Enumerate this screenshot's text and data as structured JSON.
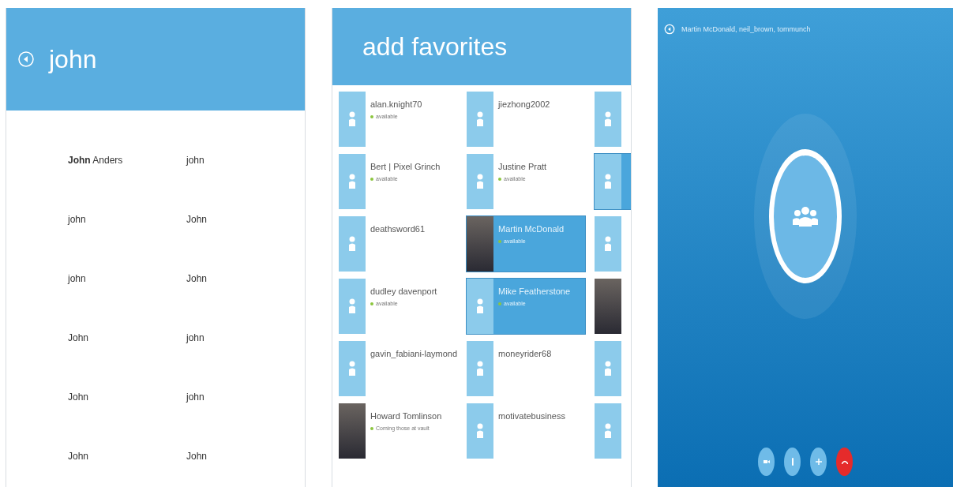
{
  "search_panel": {
    "title": "john",
    "results": [
      {
        "name": "**John** Anders"
      },
      {
        "name": "john"
      },
      {
        "name": "john"
      },
      {
        "name": "John"
      },
      {
        "name": "john"
      },
      {
        "name": "John"
      },
      {
        "name": "John"
      },
      {
        "name": "john"
      },
      {
        "name": "John"
      },
      {
        "name": "john"
      },
      {
        "name": "John"
      },
      {
        "name": "John"
      }
    ]
  },
  "favorites_panel": {
    "title": "add favorites",
    "columns": [
      [
        {
          "name": "alan.knight70",
          "status": "available",
          "selected": false,
          "kind": "default"
        },
        {
          "name": "Bert | Pixel Grinch",
          "status": "available",
          "selected": false,
          "kind": "default"
        },
        {
          "name": "deathsword61",
          "selected": false,
          "kind": "default"
        },
        {
          "name": "dudley davenport",
          "status": "available",
          "selected": false,
          "kind": "default"
        },
        {
          "name": "gavin_fabiani-laymond",
          "selected": false,
          "kind": "default"
        },
        {
          "name": "Howard Tomlinson",
          "status": "Coming those at vault",
          "selected": false,
          "kind": "photo"
        }
      ],
      [
        {
          "name": "jiezhong2002",
          "selected": false,
          "kind": "default"
        },
        {
          "name": "Justine Pratt",
          "status": "available",
          "selected": false,
          "kind": "default"
        },
        {
          "name": "Martin McDonald",
          "status": "available",
          "selected": true,
          "kind": "photo"
        },
        {
          "name": "Mike Featherstone",
          "status": "available",
          "selected": true,
          "kind": "default"
        },
        {
          "name": "moneyrider68",
          "selected": false,
          "kind": "default"
        },
        {
          "name": "motivatebusiness",
          "selected": false,
          "kind": "default"
        }
      ],
      [
        {
          "selected": false,
          "kind": "default"
        },
        {
          "selected": true,
          "kind": "default"
        },
        {
          "selected": false,
          "kind": "default"
        },
        {
          "selected": false,
          "kind": "photo"
        },
        {
          "selected": false,
          "kind": "default"
        },
        {
          "selected": false,
          "kind": "default"
        }
      ]
    ]
  },
  "call_panel": {
    "participants": "Martin McDonald, neil_brown, tommunch",
    "controls": [
      {
        "kind": "video"
      },
      {
        "kind": "mic"
      },
      {
        "kind": "add"
      },
      {
        "kind": "hangup"
      }
    ]
  }
}
